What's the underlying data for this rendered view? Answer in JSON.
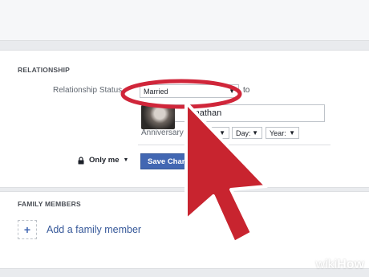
{
  "relationship_section": {
    "title": "RELATIONSHIP",
    "status_label": "Relationship Status",
    "status_value": "Married",
    "to_label": "to",
    "partner_name": "Jonathan",
    "anniversary_label": "Anniversary",
    "day_select": "Day:",
    "year_select": "Year:"
  },
  "actions": {
    "privacy_label": "Only me",
    "save_label": "Save Changes"
  },
  "family_section": {
    "title": "FAMILY MEMBERS",
    "add_label": "Add a family member"
  },
  "overlay": {
    "highlight_color": "#d0263a",
    "arrow_color": "#c8242f",
    "watermark_wiki": "wiki",
    "watermark_how": "How"
  }
}
